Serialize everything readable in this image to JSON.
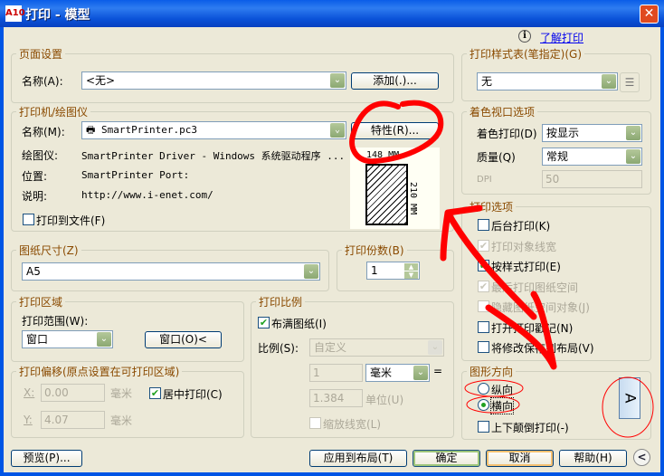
{
  "window": {
    "title": "打印 - 模型",
    "app_icon": "A10",
    "close": "✕"
  },
  "help": {
    "link": "了解打印",
    "icon": "i"
  },
  "page_setup": {
    "group": "页面设置",
    "name_label": "名称(A):",
    "name_value": "<无>",
    "add_button": "添加(.)..."
  },
  "printer": {
    "group": "打印机/绘图仪",
    "name_label": "名称(M):",
    "name_value": "SmartPrinter.pc3",
    "properties_button": "特性(R)...",
    "plotter_label": "绘图仪:",
    "plotter_value": "SmartPrinter Driver - Windows 系统驱动程序 ...",
    "location_label": "位置:",
    "location_value": "SmartPrinter Port:",
    "description_label": "说明:",
    "description_value": "http://www.i-enet.com/",
    "print_to_file": "打印到文件(F)",
    "preview_width": "148 MM",
    "preview_height": "210 MM"
  },
  "paper_size": {
    "group": "图纸尺寸(Z)",
    "value": "A5"
  },
  "copies": {
    "group": "打印份数(B)",
    "value": "1"
  },
  "plot_area": {
    "group": "打印区域",
    "range_label": "打印范围(W):",
    "range_value": "窗口",
    "window_button": "窗口(O)<"
  },
  "plot_offset": {
    "group": "打印偏移(原点设置在可打印区域)",
    "x_label": "X:",
    "x_value": "0.00",
    "y_label": "Y:",
    "y_value": "4.07",
    "unit": "毫米",
    "center_label": "居中打印(C)",
    "center_checked": true
  },
  "plot_scale": {
    "group": "打印比例",
    "fit_label": "布满图纸(I)",
    "fit_checked": true,
    "scale_label": "比例(S):",
    "scale_value": "自定义",
    "value1": "1",
    "unit1": "毫米",
    "equals": "=",
    "value2": "1.384",
    "unit2": "单位(U)",
    "scale_lineweights": "缩放线宽(L)"
  },
  "plot_style": {
    "group": "打印样式表(笔指定)(G)",
    "value": "无"
  },
  "shaded": {
    "group": "着色视口选项",
    "shade_label": "着色打印(D)",
    "shade_value": "按显示",
    "quality_label": "质量(Q)",
    "quality_value": "常规",
    "dpi_label": "DPI",
    "dpi_value": "50"
  },
  "options": {
    "group": "打印选项",
    "items": [
      {
        "label": "后台打印(K)",
        "checked": false,
        "disabled": false
      },
      {
        "label": "打印对象线宽",
        "checked": true,
        "disabled": true
      },
      {
        "label": "按样式打印(E)",
        "checked": true,
        "disabled": false
      },
      {
        "label": "最后打印图纸空间",
        "checked": true,
        "disabled": true
      },
      {
        "label": "隐藏图纸空间对象(J)",
        "checked": false,
        "disabled": true
      },
      {
        "label": "打开打印戳记(N)",
        "checked": false,
        "disabled": false
      },
      {
        "label": "将修改保存到布局(V)",
        "checked": false,
        "disabled": false
      }
    ]
  },
  "orientation": {
    "group": "图形方向",
    "portrait": "纵向",
    "landscape": "横向",
    "upside_down": "上下颠倒打印(-)",
    "selected": "landscape",
    "icon_letter": "A"
  },
  "buttons": {
    "preview": "预览(P)...",
    "apply": "应用到布局(T)",
    "ok": "确定",
    "cancel": "取消",
    "help": "帮助(H)",
    "more": "<"
  },
  "annotation_color": "#ff0000"
}
